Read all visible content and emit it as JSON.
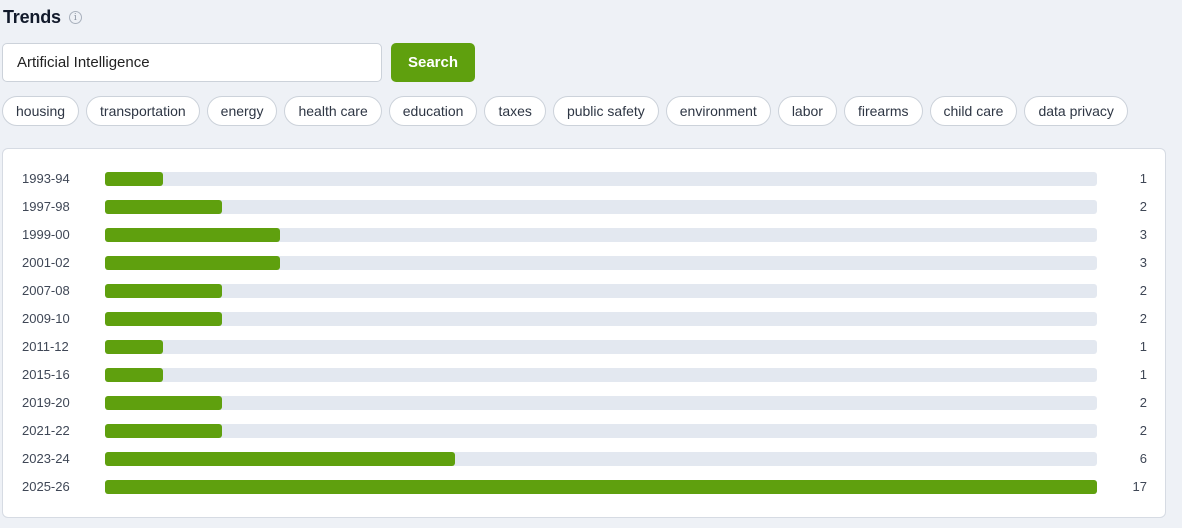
{
  "header": {
    "title": "Trends",
    "info_icon": "info-icon"
  },
  "search": {
    "value": "Artificial Intelligence",
    "button_label": "Search"
  },
  "topics": [
    "housing",
    "transportation",
    "energy",
    "health care",
    "education",
    "taxes",
    "public safety",
    "environment",
    "labor",
    "firearms",
    "child care",
    "data privacy"
  ],
  "colors": {
    "accent": "#5fa00e",
    "track": "#e3e8f0",
    "background": "#eef1f6"
  },
  "chart_data": {
    "type": "bar",
    "orientation": "horizontal",
    "categories": [
      "1993-94",
      "1997-98",
      "1999-00",
      "2001-02",
      "2007-08",
      "2009-10",
      "2011-12",
      "2015-16",
      "2019-20",
      "2021-22",
      "2023-24",
      "2025-26"
    ],
    "values": [
      1,
      2,
      3,
      3,
      2,
      2,
      1,
      1,
      2,
      2,
      6,
      17
    ],
    "xlim": [
      0,
      17
    ],
    "grid": false
  }
}
